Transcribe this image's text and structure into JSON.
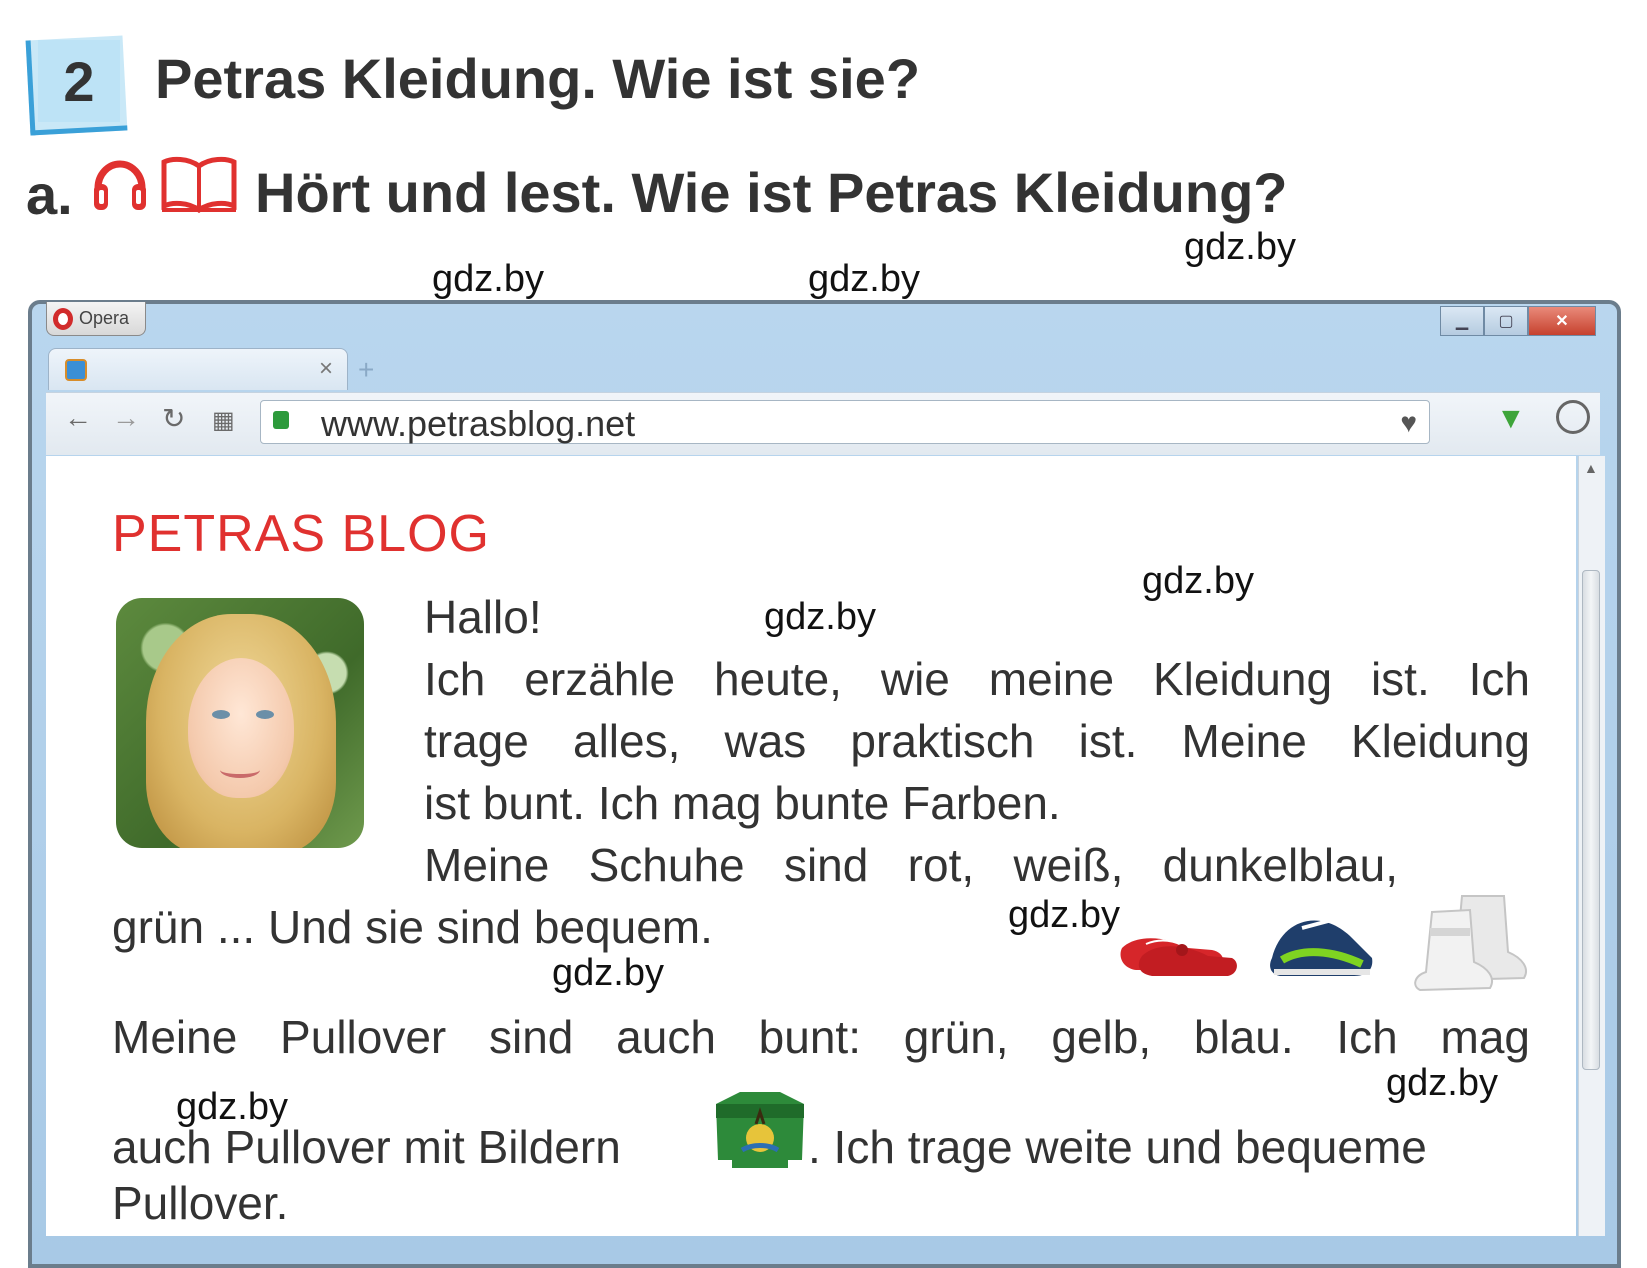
{
  "task": {
    "number": "2",
    "title": "Petras Kleidung. Wie ist sie?",
    "sub_letter": "a.",
    "sub_title": "Hört und lest. Wie ist Petras Kleidung?"
  },
  "icons": [
    "headphones-icon",
    "book-icon"
  ],
  "watermark": "gdz.by",
  "browser": {
    "app_name": "Opera",
    "url": "www.petrasblog.net",
    "tab_close": "×",
    "new_tab": "+"
  },
  "blog": {
    "title": "PETRAS BLOG",
    "greeting": "Hallo!",
    "line1": "Ich erzähle heute, wie meine Kleidung ist. Ich",
    "line2": "trage alles, was praktisch ist. Meine Kleidung",
    "line3": "ist bunt. Ich mag bunte Farben.",
    "line4": "Meine Schuhe sind rot, weiß, dunkelblau,",
    "line5": "grün ... Und sie sind bequem.",
    "line6": "Meine Pullover sind auch bunt: grün, gelb, blau. Ich mag",
    "line7a": "auch Pullover mit Bildern",
    "line7b": ". Ich trage weite und bequeme",
    "line8": "Pullover."
  },
  "colors": {
    "blog_title": "#e0312f",
    "number_box": "#bde3f6",
    "icon_red": "#e0312f"
  }
}
